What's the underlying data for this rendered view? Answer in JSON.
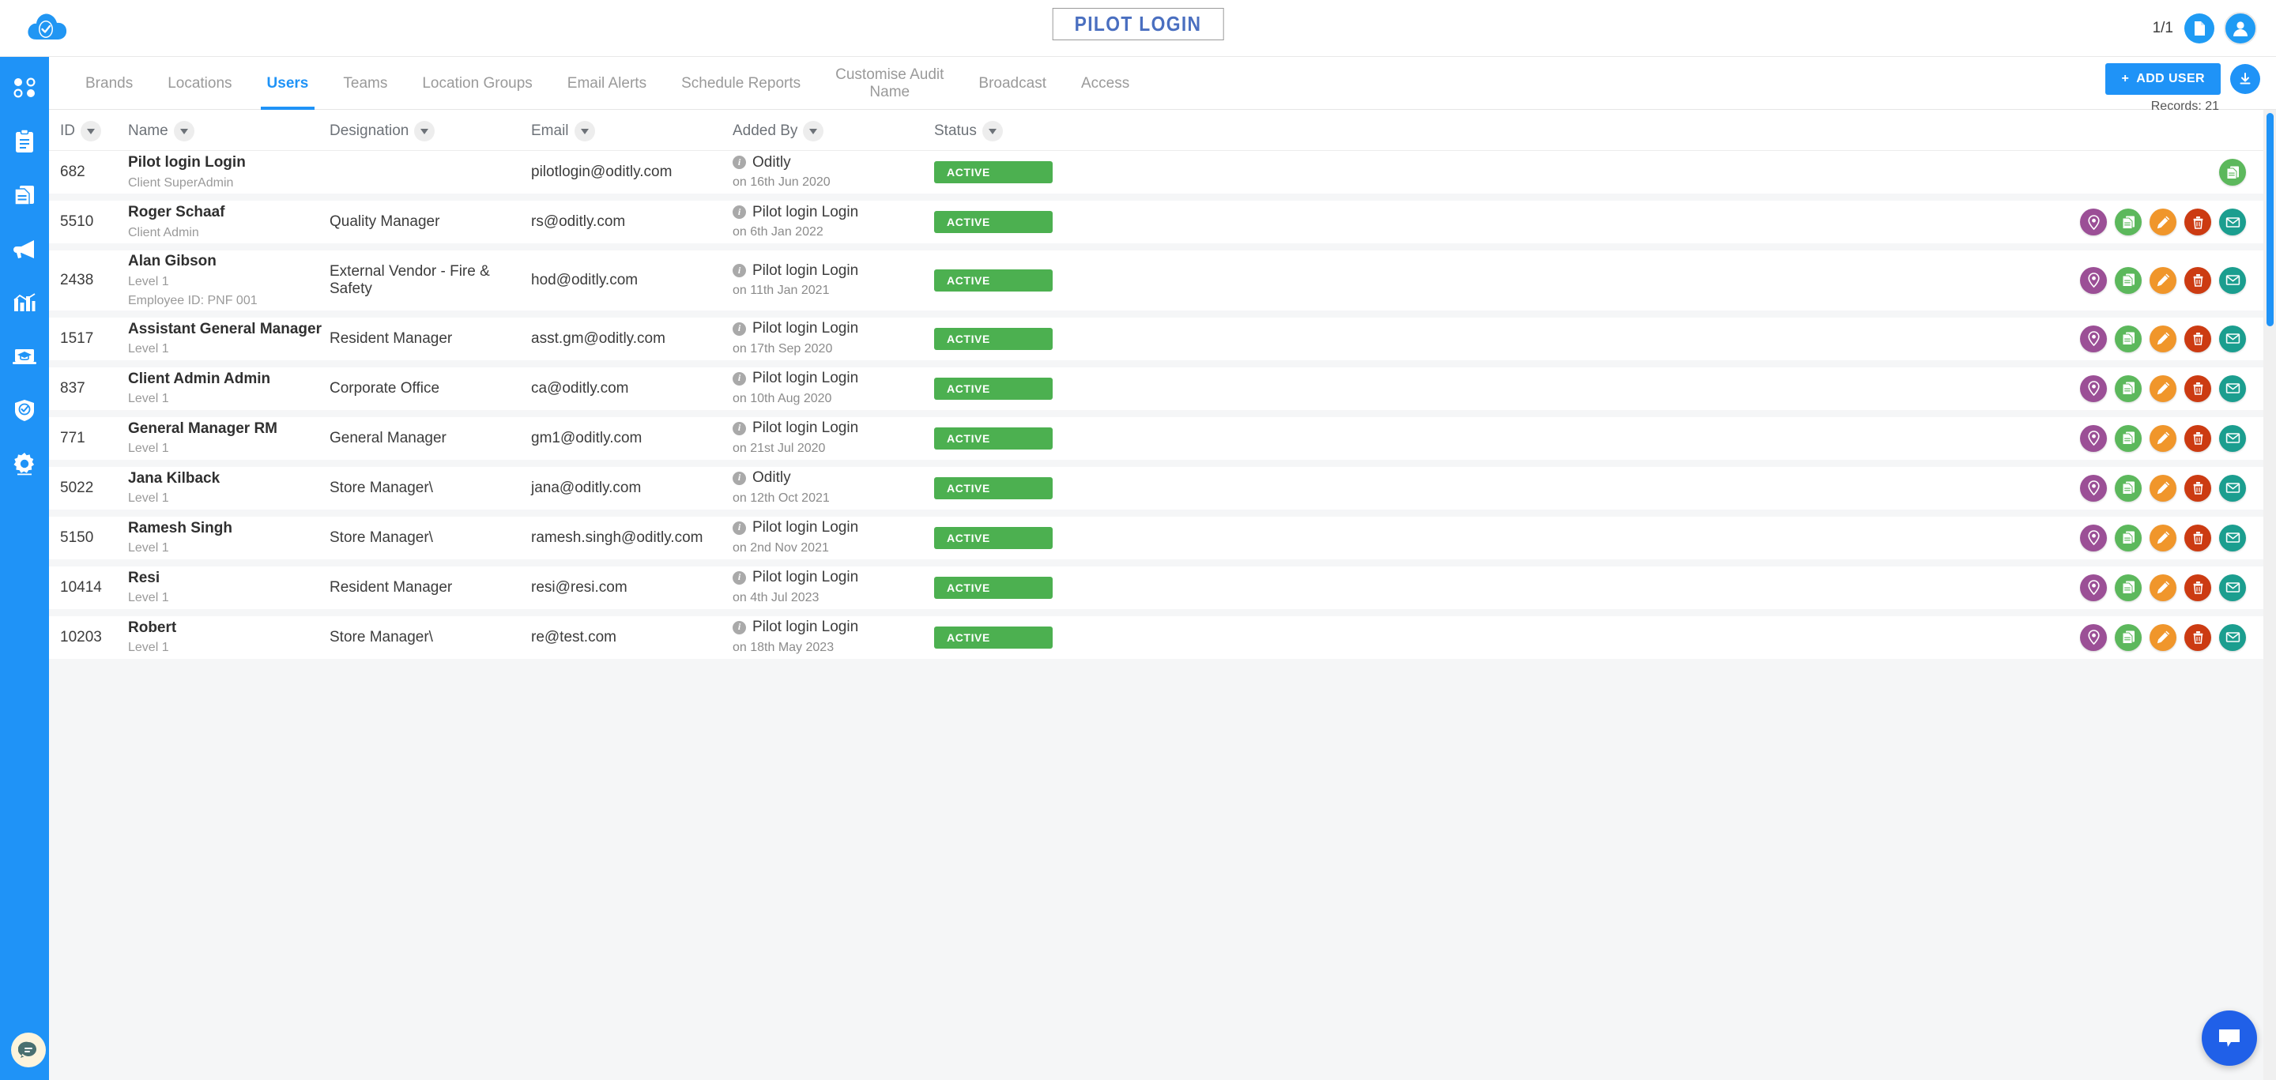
{
  "header": {
    "brand_title": "PILOT LOGIN",
    "page_count": "1/1",
    "logo_icon": "cloud-check-icon",
    "doc_icon": "document-icon",
    "avatar_icon": "user-avatar-icon"
  },
  "sidebar": {
    "items": [
      {
        "icon": "dashboard-dots-icon",
        "name": "dashboard"
      },
      {
        "icon": "clipboard-icon",
        "name": "audits"
      },
      {
        "icon": "documents-icon",
        "name": "reports"
      },
      {
        "icon": "megaphone-icon",
        "name": "broadcast"
      },
      {
        "icon": "bar-chart-icon",
        "name": "analytics"
      },
      {
        "icon": "elearning-icon",
        "name": "learning"
      },
      {
        "icon": "shield-check-icon",
        "name": "compliance"
      },
      {
        "icon": "gear-icon",
        "name": "settings"
      }
    ]
  },
  "tabs": [
    {
      "label": "Brands",
      "active": false
    },
    {
      "label": "Locations",
      "active": false
    },
    {
      "label": "Users",
      "active": true
    },
    {
      "label": "Teams",
      "active": false
    },
    {
      "label": "Location Groups",
      "active": false
    },
    {
      "label": "Email Alerts",
      "active": false
    },
    {
      "label": "Schedule Reports",
      "active": false
    },
    {
      "label": "Customise Audit\nName",
      "active": false
    },
    {
      "label": "Broadcast",
      "active": false
    },
    {
      "label": "Access",
      "active": false
    }
  ],
  "toolbar": {
    "add_user_label": "ADD USER",
    "add_plus": "+",
    "download_icon": "download-icon",
    "records_label": "Records: 21"
  },
  "table": {
    "columns": [
      {
        "label": "ID"
      },
      {
        "label": "Name"
      },
      {
        "label": "Designation"
      },
      {
        "label": "Email"
      },
      {
        "label": "Added By"
      },
      {
        "label": "Status"
      }
    ],
    "rows": [
      {
        "id": "682",
        "name": "Pilot login Login",
        "sub1": "Client SuperAdmin",
        "sub2": "",
        "designation": "",
        "email": "pilotlogin@oditly.com",
        "added_by": "Oditly",
        "added_on": "on 16th Jun 2020",
        "status": "ACTIVE",
        "actions": [
          "doc"
        ]
      },
      {
        "id": "5510",
        "name": "Roger Schaaf",
        "sub1": "Client Admin",
        "sub2": "",
        "designation": "Quality Manager",
        "email": "rs@oditly.com",
        "added_by": "Pilot login Login",
        "added_on": "on 6th Jan 2022",
        "status": "ACTIVE",
        "actions": [
          "loc",
          "doc",
          "edit",
          "del",
          "mail"
        ]
      },
      {
        "id": "2438",
        "name": "Alan Gibson",
        "sub1": "Level 1",
        "sub2": "Employee ID: PNF 001",
        "designation": "External Vendor - Fire & Safety",
        "email": "hod@oditly.com",
        "added_by": "Pilot login Login",
        "added_on": "on 11th Jan 2021",
        "status": "ACTIVE",
        "actions": [
          "loc",
          "doc",
          "edit",
          "del",
          "mail"
        ]
      },
      {
        "id": "1517",
        "name": "Assistant General Manager",
        "sub1": "Level 1",
        "sub2": "",
        "designation": "Resident Manager",
        "email": "asst.gm@oditly.com",
        "added_by": "Pilot login Login",
        "added_on": "on 17th Sep 2020",
        "status": "ACTIVE",
        "actions": [
          "loc",
          "doc",
          "edit",
          "del",
          "mail"
        ]
      },
      {
        "id": "837",
        "name": "Client Admin Admin",
        "sub1": "Level 1",
        "sub2": "",
        "designation": "Corporate Office",
        "email": "ca@oditly.com",
        "added_by": "Pilot login Login",
        "added_on": "on 10th Aug 2020",
        "status": "ACTIVE",
        "actions": [
          "loc",
          "doc",
          "edit",
          "del",
          "mail"
        ]
      },
      {
        "id": "771",
        "name": "General Manager RM",
        "sub1": "Level 1",
        "sub2": "",
        "designation": "General Manager",
        "email": "gm1@oditly.com",
        "added_by": "Pilot login Login",
        "added_on": "on 21st Jul 2020",
        "status": "ACTIVE",
        "actions": [
          "loc",
          "doc",
          "edit",
          "del",
          "mail"
        ]
      },
      {
        "id": "5022",
        "name": "Jana Kilback",
        "sub1": "Level 1",
        "sub2": "",
        "designation": "Store Manager\\",
        "email": "jana@oditly.com",
        "added_by": "Oditly",
        "added_on": "on 12th Oct 2021",
        "status": "ACTIVE",
        "actions": [
          "loc",
          "doc",
          "edit",
          "del",
          "mail"
        ]
      },
      {
        "id": "5150",
        "name": "Ramesh Singh",
        "sub1": "Level 1",
        "sub2": "",
        "designation": "Store Manager\\",
        "email": "ramesh.singh@oditly.com",
        "added_by": "Pilot login Login",
        "added_on": "on 2nd Nov 2021",
        "status": "ACTIVE",
        "actions": [
          "loc",
          "doc",
          "edit",
          "del",
          "mail"
        ]
      },
      {
        "id": "10414",
        "name": "Resi",
        "sub1": "Level 1",
        "sub2": "",
        "designation": "Resident Manager",
        "email": "resi@resi.com",
        "added_by": "Pilot login Login",
        "added_on": "on 4th Jul 2023",
        "status": "ACTIVE",
        "actions": [
          "loc",
          "doc",
          "edit",
          "del",
          "mail"
        ]
      },
      {
        "id": "10203",
        "name": "Robert",
        "sub1": "Level 1",
        "sub2": "",
        "designation": "Store Manager\\",
        "email": "re@test.com",
        "added_by": "Pilot login Login",
        "added_on": "on 18th May 2023",
        "status": "ACTIVE",
        "actions": [
          "loc",
          "doc",
          "edit",
          "del",
          "mail"
        ]
      }
    ]
  },
  "floating": {
    "chat_left_icon": "chat-bubble-icon",
    "chat_right_icon": "chat-bubble-icon"
  },
  "colors": {
    "primary": "#1f93f7",
    "active_badge": "#4cb050",
    "location": "#9b4f96",
    "document": "#5cb85c",
    "edit": "#f0962b",
    "delete": "#cc3b12",
    "mail": "#1b9e8f",
    "brand_text": "#4a6fc0"
  }
}
